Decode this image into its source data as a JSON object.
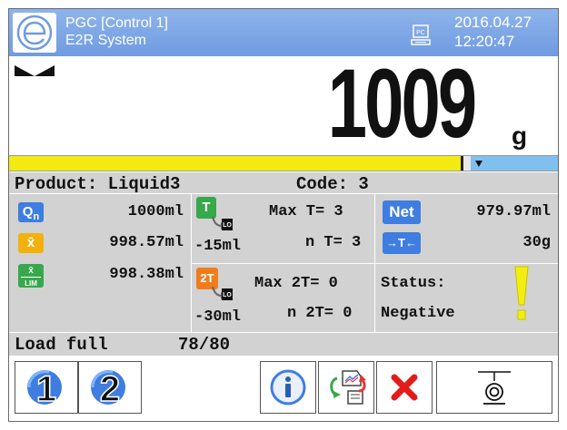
{
  "titlebar": {
    "title": "PGC [Control 1]",
    "subtitle": "E2R System",
    "date": "2016.04.27",
    "time": "12:20:47",
    "pc_icon_label": "PC"
  },
  "weight": {
    "value": "1009",
    "unit": "g"
  },
  "fill_bar": {
    "level_percent": 80,
    "colors": {
      "fill": "#f3ea12",
      "target": "#7fc0ef"
    }
  },
  "info": {
    "product": "Product: Liquid3",
    "code": "Code: 3",
    "qn": {
      "badge": "Qn",
      "value": "1000ml"
    },
    "mean": {
      "badge": "x̄",
      "value": "998.57ml"
    },
    "mean_lim": {
      "badge_top": "x̄",
      "badge_bottom": "LIM",
      "value": "998.38ml"
    },
    "t1": {
      "badge": "T",
      "sub": "LO",
      "offset": "-15ml",
      "max": "Max T= 3",
      "n": "n T= 3"
    },
    "t2": {
      "badge": "2T",
      "sub": "LO",
      "offset": "-30ml",
      "max": "Max 2T= 0",
      "n": "n 2T= 0"
    },
    "net": {
      "badge": "Net",
      "value": "979.97ml"
    },
    "tare": {
      "badge": "→T←",
      "value": "30g"
    },
    "status_label": "Status:",
    "status_value": "Negative"
  },
  "load": {
    "label": "Load full",
    "count": "78/80"
  },
  "buttons": [
    {
      "name": "scale-1-button",
      "icon": "digit-1-icon"
    },
    {
      "name": "scale-2-button",
      "icon": "digit-2-icon"
    },
    {
      "name": "info-button",
      "icon": "info-icon"
    },
    {
      "name": "transfer-button",
      "icon": "transfer-icon"
    },
    {
      "name": "cancel-button",
      "icon": "close-icon"
    },
    {
      "name": "tare-button",
      "icon": "zero-icon"
    }
  ],
  "colors": {
    "accent": "#6f9be0",
    "panel": "#d2d2d2",
    "warning": "#f4ee10"
  }
}
